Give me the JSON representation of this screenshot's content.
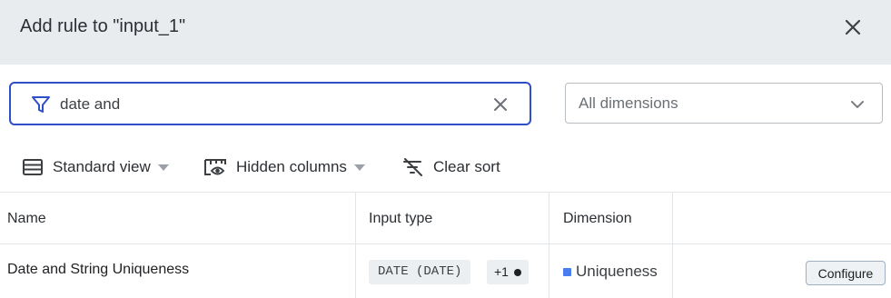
{
  "dialog": {
    "title": "Add rule to \"input_1\"",
    "close_icon": "close-icon"
  },
  "search": {
    "value": "date and",
    "icon": "filter-icon",
    "clear_icon": "clear-icon"
  },
  "dimension_select": {
    "selected": "All dimensions",
    "icon": "chevron-down-icon"
  },
  "toolbar": {
    "standard_view": "Standard view",
    "hidden_columns": "Hidden columns",
    "clear_sort": "Clear sort"
  },
  "table": {
    "columns": [
      "Name",
      "Input type",
      "Dimension",
      ""
    ],
    "rows": [
      {
        "name": "Date and String Uniqueness",
        "input_type": "DATE (DATE)",
        "extra_types": "+1",
        "dimension": "Uniqueness",
        "dimension_color": "#4a7bef",
        "action": "Configure"
      }
    ]
  },
  "colors": {
    "accent": "#2f4fc9",
    "header_bg": "#e8ecef"
  }
}
